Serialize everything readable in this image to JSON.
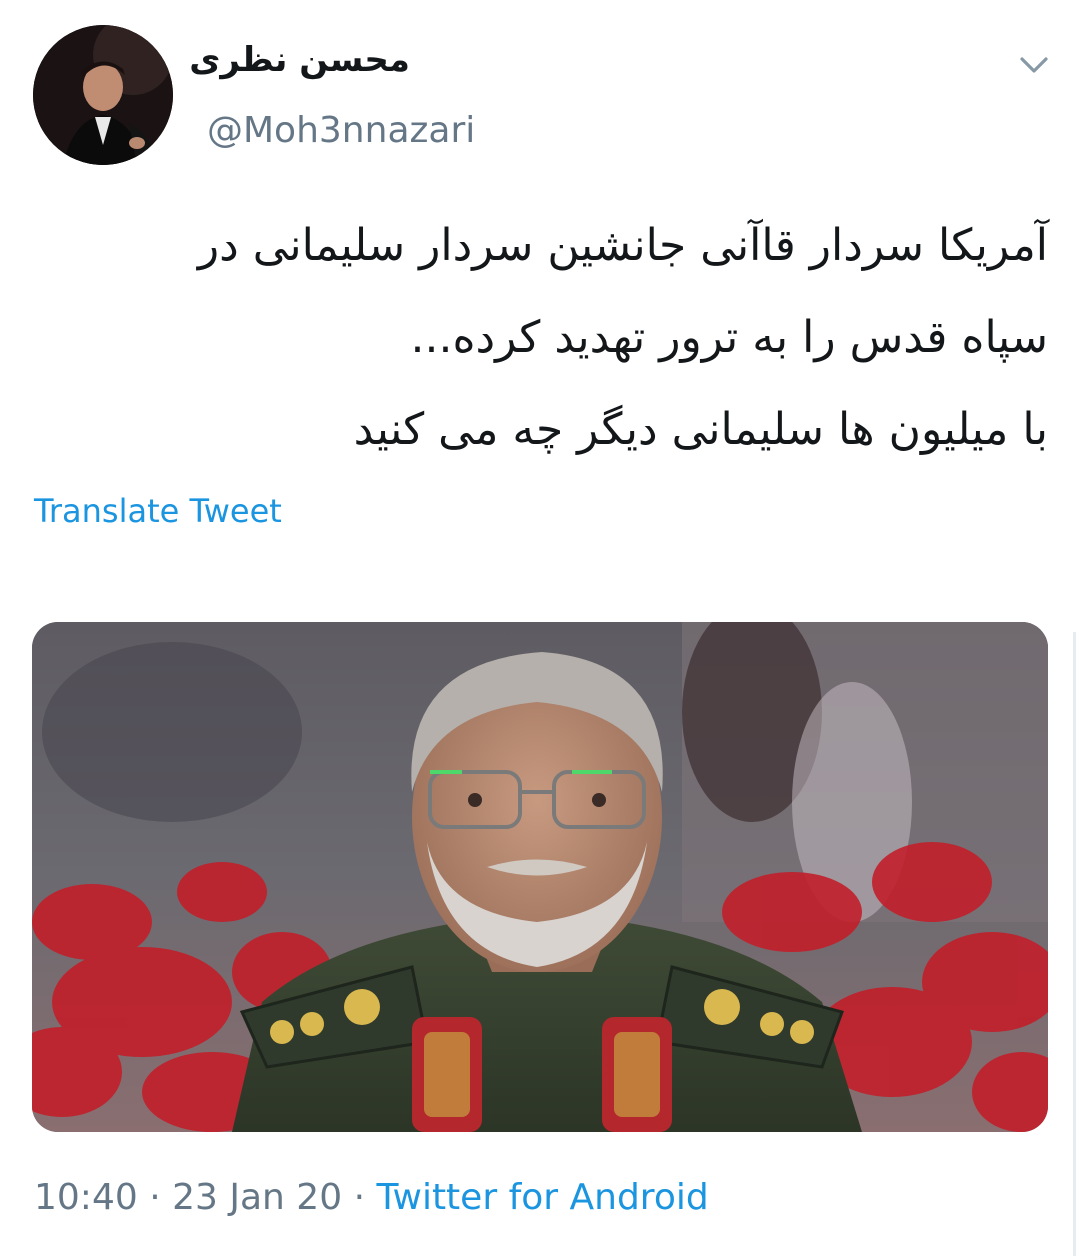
{
  "tweet": {
    "author": {
      "display_name": "محسن نظری",
      "username": "@Moh3nnazari",
      "avatar_icon": "profile-photo"
    },
    "menu_icon": "chevron-down-icon",
    "text_lines": [
      "آمریکا سردار قاآنی جانشین سردار سلیمانی در",
      "سپاه قدس را به ترور تهدید کرده...",
      "با میلیون ها سلیمانی دیگر چه می کنید"
    ],
    "translate_label": "Translate Tweet",
    "media": {
      "alt_description_icon": "tweet-photo"
    },
    "meta": {
      "time": "10:40",
      "separator": "·",
      "date": "23 Jan 20",
      "source": "Twitter for Android"
    }
  },
  "colors": {
    "text_primary": "#14171a",
    "text_secondary": "#657786",
    "link": "#1b95e0"
  }
}
